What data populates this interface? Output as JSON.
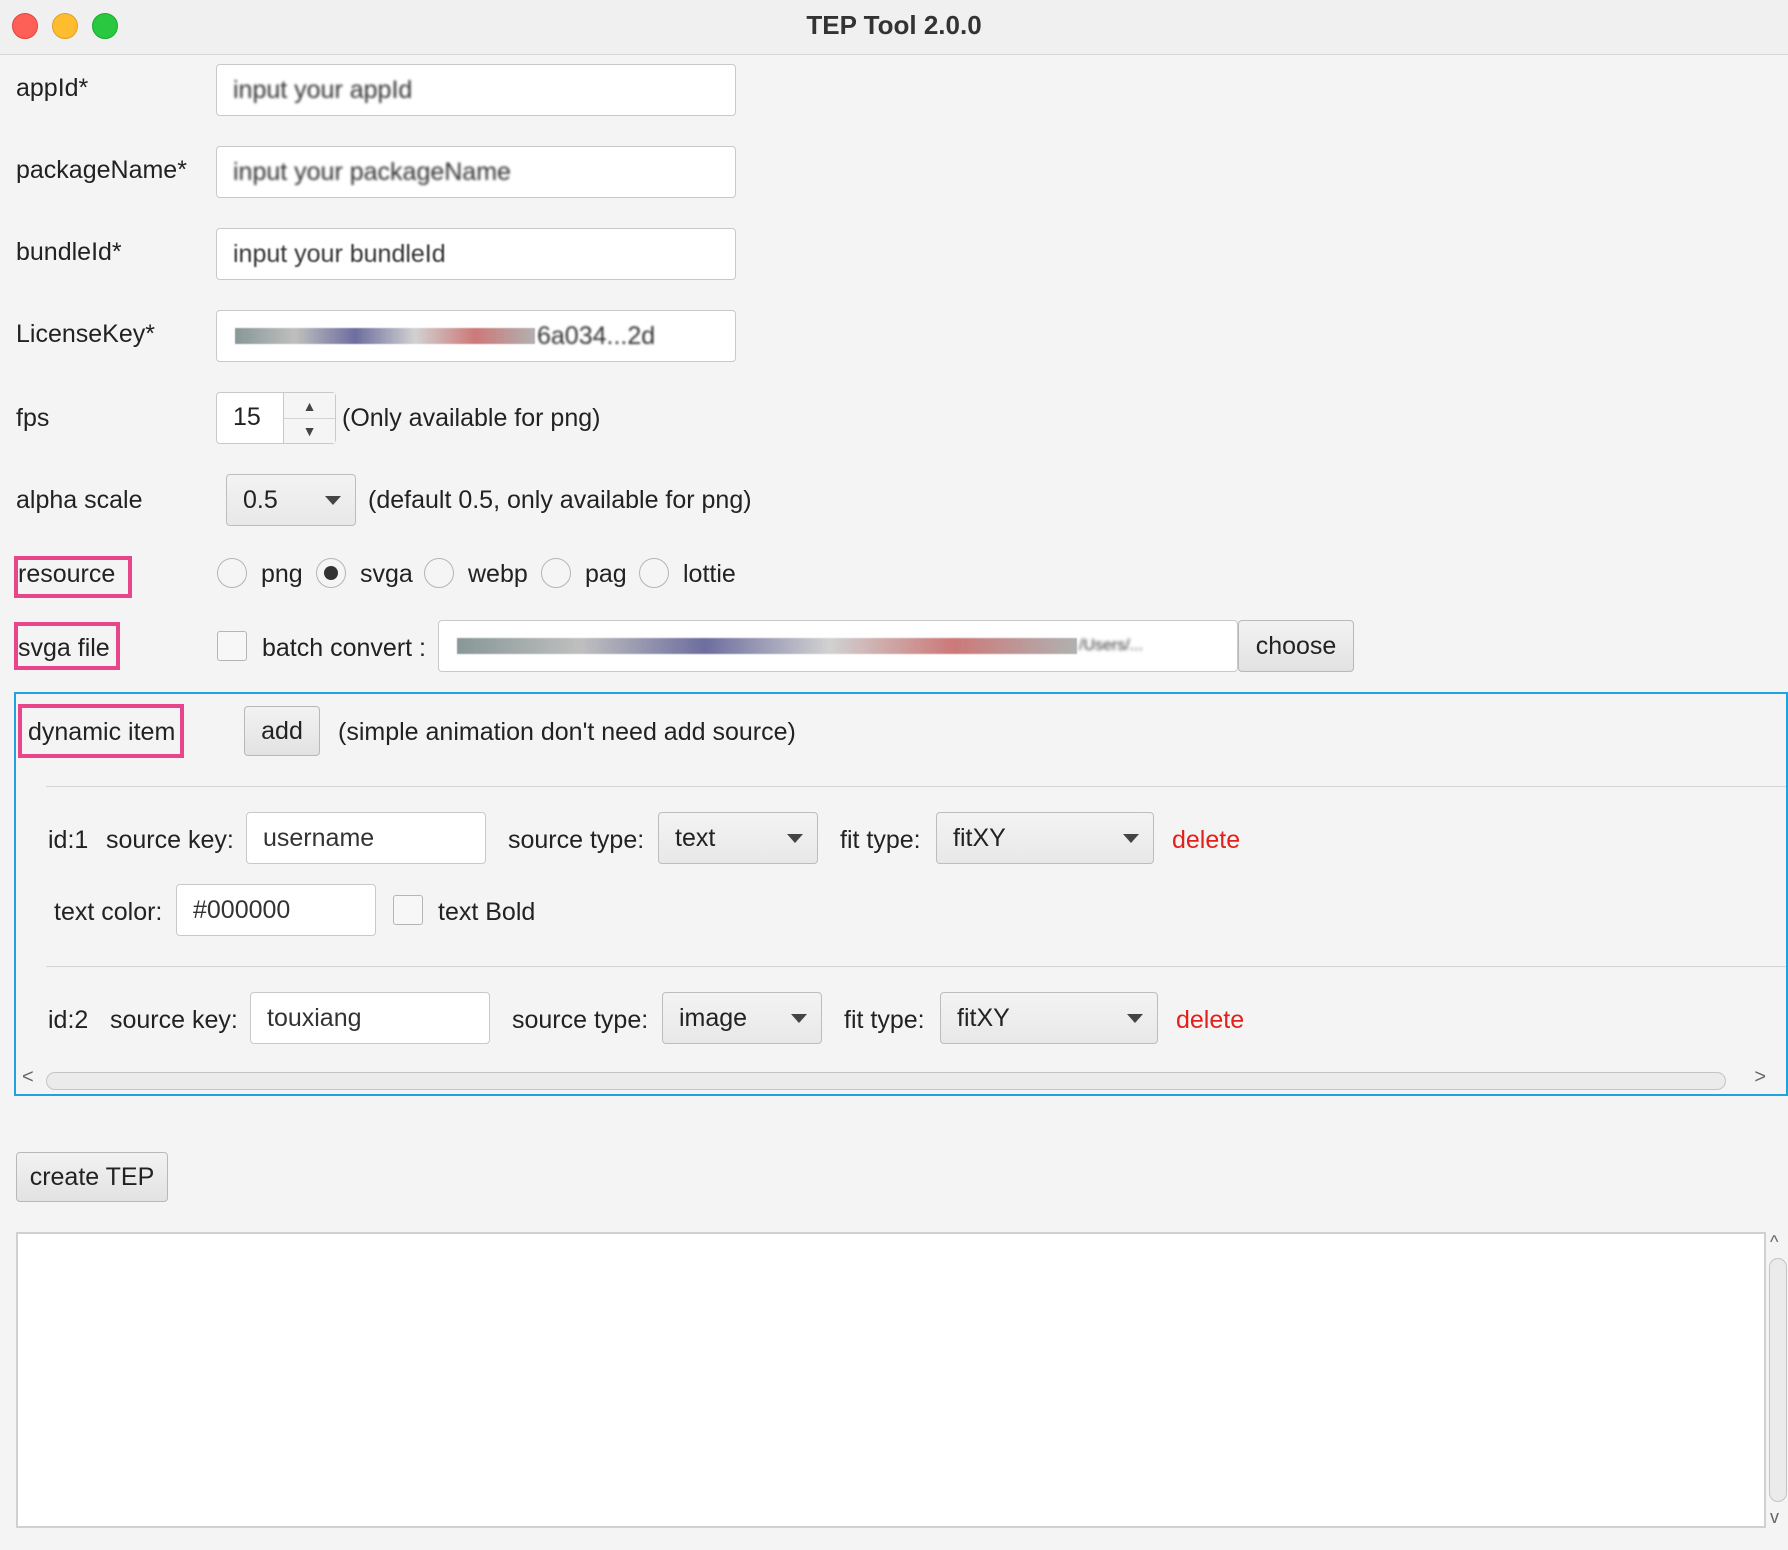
{
  "window": {
    "title": "TEP Tool 2.0.0"
  },
  "form": {
    "appid": {
      "label": "appId*",
      "value": "input your appId"
    },
    "package": {
      "label": "packageName*",
      "value": "input your packageName"
    },
    "bundle": {
      "label": "bundleId*",
      "value": "input your bundleId"
    },
    "license": {
      "label": "LicenseKey*",
      "value": "6a034...2d"
    },
    "fps": {
      "label": "fps",
      "value": "15",
      "hint": "(Only available for png)"
    },
    "alpha": {
      "label": "alpha scale",
      "value": "0.5",
      "hint": "(default 0.5, only available for png)"
    },
    "resource": {
      "label": "resource",
      "options": [
        "png",
        "svga",
        "webp",
        "pag",
        "lottie"
      ],
      "selected": "svga"
    },
    "svga": {
      "label": "svga file",
      "batch_label": "batch convert :",
      "path": "/Users/...",
      "choose": "choose"
    }
  },
  "dynamic": {
    "label": "dynamic item",
    "add": "add",
    "hint": "(simple animation don't need add source)",
    "items": [
      {
        "id": "id:1",
        "source_key_label": "source key:",
        "source_key": "username",
        "source_type_label": "source type:",
        "source_type": "text",
        "fit_type_label": "fit type:",
        "fit_type": "fitXY",
        "delete": "delete",
        "text_color_label": "text color:",
        "text_color": "#000000",
        "text_bold": "text Bold"
      },
      {
        "id": "id:2",
        "source_key_label": "source key:",
        "source_key": "touxiang",
        "source_type_label": "source type:",
        "source_type": "image",
        "fit_type_label": "fit type:",
        "fit_type": "fitXY",
        "delete": "delete"
      }
    ]
  },
  "actions": {
    "create": "create TEP"
  },
  "console": {
    "text": ""
  },
  "colors": {
    "highlight": "#e8458b",
    "panel_border": "#1ea2e0",
    "delete": "#e3201b"
  }
}
